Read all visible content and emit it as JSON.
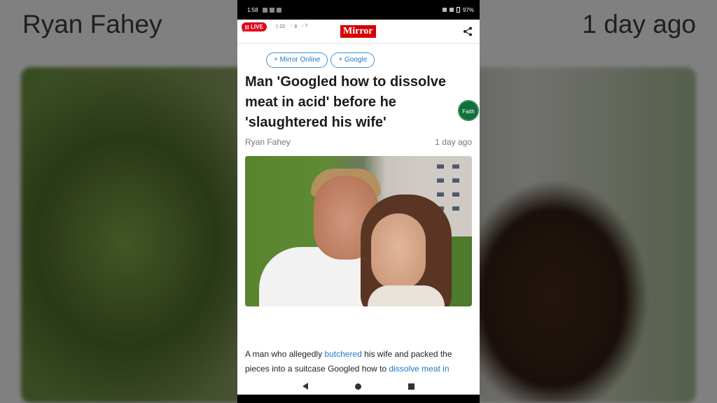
{
  "background": {
    "author": "Ryan Fahey",
    "date": "1 day ago"
  },
  "status_bar": {
    "time": "1:58",
    "battery": "97%"
  },
  "top_bar": {
    "live_label": "LIVE",
    "stats": {
      "readers": "23",
      "likes": "8",
      "comments": "7"
    },
    "logo": "Mirror"
  },
  "follow_pills": [
    {
      "label": "+ Mirror Online"
    },
    {
      "label": "+ Google"
    }
  ],
  "article": {
    "headline": "Man 'Googled how to dissolve meat in acid' before he 'slaughtered his wife'",
    "author": "Ryan Fahey",
    "date": "1 day ago",
    "body_parts": {
      "p1": "A man who allegedly ",
      "link1": "butchered",
      "p2": " his wife and packed the pieces into a suitcase Googled how to ",
      "link2": "dissolve meat in"
    }
  },
  "faith_badge": {
    "label": "Faith"
  },
  "colors": {
    "accent": "#1f78c8",
    "brand_red": "#d40000",
    "live_red": "#e3001b"
  },
  "icons": [
    "back-arrow-icon",
    "share-icon",
    "nav-back-icon",
    "nav-home-icon",
    "nav-recent-icon"
  ]
}
